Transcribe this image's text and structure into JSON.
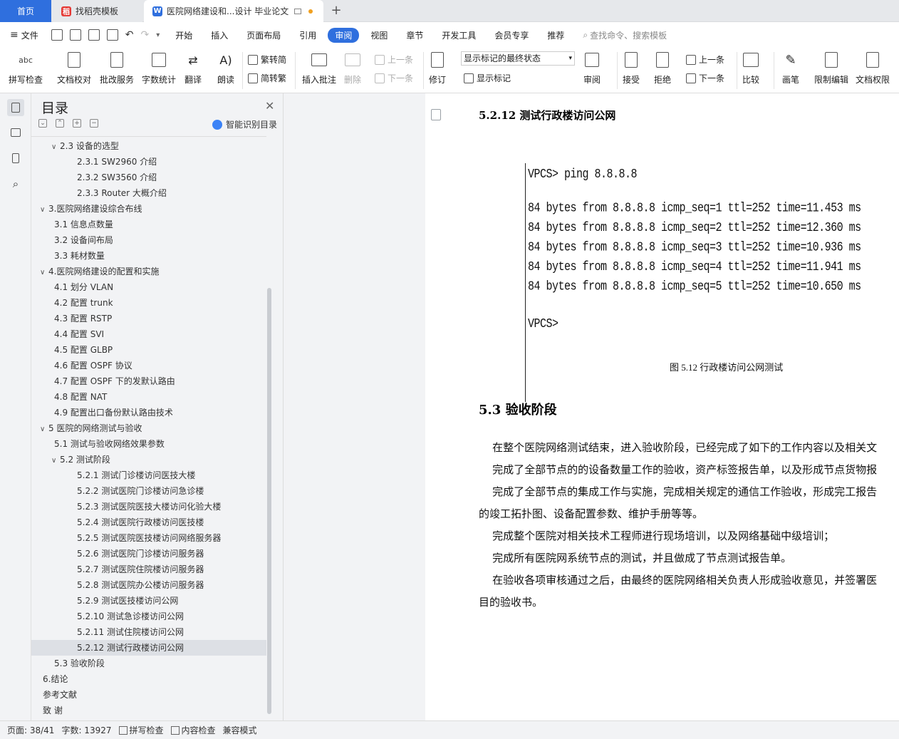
{
  "tabs": {
    "home": "首页",
    "template": "找稻壳模板",
    "document": "医院网络建设和...设计 毕业论文"
  },
  "menu": {
    "file": "文件",
    "items": [
      "开始",
      "插入",
      "页面布局",
      "引用",
      "审阅",
      "视图",
      "章节",
      "开发工具",
      "会员专享",
      "推荐"
    ],
    "active": "审阅",
    "search_placeholder": "查找命令、搜索模板"
  },
  "ribbon": {
    "spell": "拼写检查",
    "proof": "文档校对",
    "revise_service": "批改服务",
    "word_count": "字数统计",
    "translate": "翻译",
    "read_aloud": "朗读",
    "trad_to_simp": "繁转简",
    "simp_to_trad": "简转繁",
    "insert_comment": "插入批注",
    "delete": "删除",
    "prev_comment": "上一条",
    "next_comment": "下一条",
    "track": "修订",
    "markup_state": "显示标记的最终状态",
    "show_markup": "显示标记",
    "review": "审阅",
    "accept": "接受",
    "reject": "拒绝",
    "prev_change": "上一条",
    "next_change": "下一条",
    "compare": "比较",
    "pen": "画笔",
    "restrict": "限制编辑",
    "permission": "文档权限"
  },
  "toc": {
    "title": "目录",
    "smart": "智能识别目录",
    "items": [
      {
        "text": "2.3 设备的选型",
        "level": 2,
        "chev": "v"
      },
      {
        "text": "2.3.1 SW2960 介绍",
        "level": 3
      },
      {
        "text": "2.3.2 SW3560 介绍",
        "level": 3
      },
      {
        "text": "2.3.3 Router 大概介绍",
        "level": 3
      },
      {
        "text": "3.医院网络建设综合布线",
        "level": 1,
        "chev": "v"
      },
      {
        "text": "3.1  信息点数量",
        "level": 2
      },
      {
        "text": "3.2  设备间布局",
        "level": 2
      },
      {
        "text": "3.3  耗材数量",
        "level": 2
      },
      {
        "text": "4.医院网络建设的配置和实施",
        "level": 1,
        "chev": "v"
      },
      {
        "text": "4.1  划分 VLAN",
        "level": 2
      },
      {
        "text": "4.2  配置 trunk",
        "level": 2
      },
      {
        "text": "4.3  配置 RSTP",
        "level": 2
      },
      {
        "text": "4.4  配置 SVI",
        "level": 2
      },
      {
        "text": "4.5  配置 GLBP",
        "level": 2
      },
      {
        "text": "4.6  配置 OSPF 协议",
        "level": 2
      },
      {
        "text": "4.7 配置 OSPF 下的发默认路由",
        "level": 2
      },
      {
        "text": "4.8 配置 NAT",
        "level": 2
      },
      {
        "text": "4.9 配置出口备份默认路由技术",
        "level": 2
      },
      {
        "text": "5 医院的网络测试与验收",
        "level": 1,
        "chev": "v"
      },
      {
        "text": "5.1 测试与验收网络效果参数",
        "level": 2
      },
      {
        "text": "5.2 测试阶段",
        "level": 2,
        "chev": "v"
      },
      {
        "text": "5.2.1 测试门诊楼访问医技大楼",
        "level": 3
      },
      {
        "text": "5.2.2 测试医院门诊楼访问急诊楼",
        "level": 3
      },
      {
        "text": "5.2.3 测试医院医技大楼访问化验大楼",
        "level": 3
      },
      {
        "text": "5.2.4 测试医院行政楼访问医技楼",
        "level": 3
      },
      {
        "text": "5.2.5 测试医院医技楼访问网络服务器",
        "level": 3
      },
      {
        "text": "5.2.6 测试医院门诊楼访问服务器",
        "level": 3
      },
      {
        "text": "5.2.7 测试医院住院楼访问服务器",
        "level": 3
      },
      {
        "text": "5.2.8 测试医院办公楼访问服务器",
        "level": 3
      },
      {
        "text": "5.2.9 测试医技楼访问公网",
        "level": 3
      },
      {
        "text": "5.2.10 测试急诊楼访问公网",
        "level": 3
      },
      {
        "text": "5.2.11 测试住院楼访问公网",
        "level": 3
      },
      {
        "text": "5.2.12 测试行政楼访问公网",
        "level": 3,
        "selected": true
      },
      {
        "text": "5.3 验收阶段",
        "level": 2
      },
      {
        "text": "6.结论",
        "level": 1
      },
      {
        "text": "参考文献",
        "level": 1
      },
      {
        "text": "致    谢",
        "level": 1
      }
    ]
  },
  "doc": {
    "heading_5212": "5.2.12 测试行政楼访问公网",
    "terminal": [
      "VPCS> ping 8.8.8.8",
      "",
      "84 bytes from 8.8.8.8 icmp_seq=1 ttl=252 time=11.453 ms",
      "84 bytes from 8.8.8.8 icmp_seq=2 ttl=252 time=12.360 ms",
      "84 bytes from 8.8.8.8 icmp_seq=3 ttl=252 time=10.936 ms",
      "84 bytes from 8.8.8.8 icmp_seq=4 ttl=252 time=11.941 ms",
      "84 bytes from 8.8.8.8 icmp_seq=5 ttl=252 time=10.650 ms",
      "",
      "VPCS>"
    ],
    "caption": "图 5.12 行政楼访问公网测试",
    "heading_53": "5.3 验收阶段",
    "paragraphs": [
      "    在整个医院网络测试结束，进入验收阶段，已经完成了如下的工作内容以及相关文",
      "    完成了全部节点的的设备数量工作的验收，资产标签报告单，以及形成节点货物报",
      "    完成了全部节点的集成工作与实施，完成相关规定的通信工作验收，形成完工报告",
      "的竣工拓扑图、设备配置参数、维护手册等等。",
      "    完成整个医院对相关技术工程师进行现场培训，以及网络基础中级培训；",
      "    完成所有医院网系统节点的测试，并且做成了节点测试报告单。",
      "    在验收各项审核通过之后，由最终的医院网络相关负责人形成验收意见，并签署医",
      "目的验收书。"
    ]
  },
  "status": {
    "page": "页面: 38/41",
    "words": "字数: 13927",
    "spell": "拼写检查",
    "content": "内容检查",
    "compat": "兼容模式"
  },
  "colors": {
    "accent": "#2f6fde",
    "selected_row": "#dde0e5"
  }
}
